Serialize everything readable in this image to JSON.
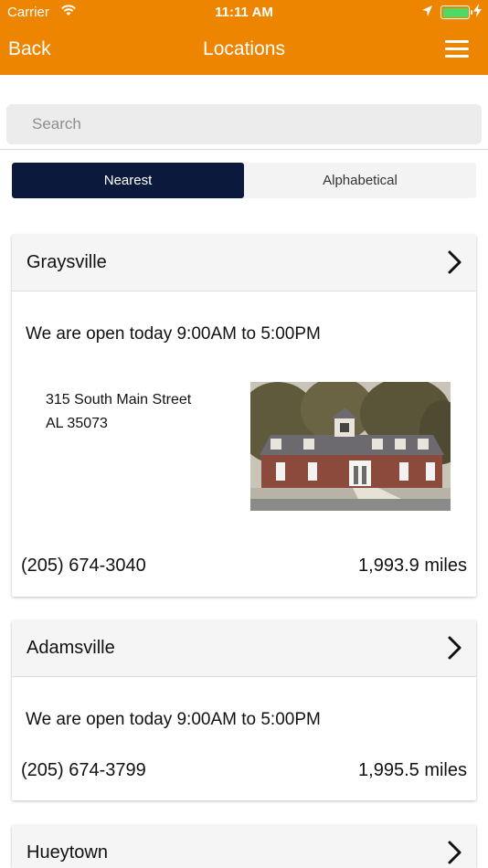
{
  "status_bar": {
    "carrier": "Carrier",
    "time": "11:11 AM",
    "battery_color": "#4cd964"
  },
  "nav": {
    "back_label": "Back",
    "title": "Locations",
    "menu_icon": "hamburger-menu-icon",
    "bar_color": "#ee8500"
  },
  "search": {
    "placeholder": "Search"
  },
  "segments": {
    "options": [
      "Nearest",
      "Alphabetical"
    ],
    "selected": "Nearest",
    "active_color": "#0b1a3c"
  },
  "locations": [
    {
      "name": "Graysville",
      "hours": "We are open today 9:00AM to 5:00PM",
      "address_line1": "315 South Main Street",
      "address_line2": "AL 35073",
      "phone": "(205) 674-3040",
      "distance": "1,993.9 miles"
    },
    {
      "name": "Adamsville",
      "hours": "We are open today 9:00AM to 5:00PM",
      "phone": "(205) 674-3799",
      "distance": "1,995.5 miles"
    },
    {
      "name": "Hueytown"
    }
  ]
}
